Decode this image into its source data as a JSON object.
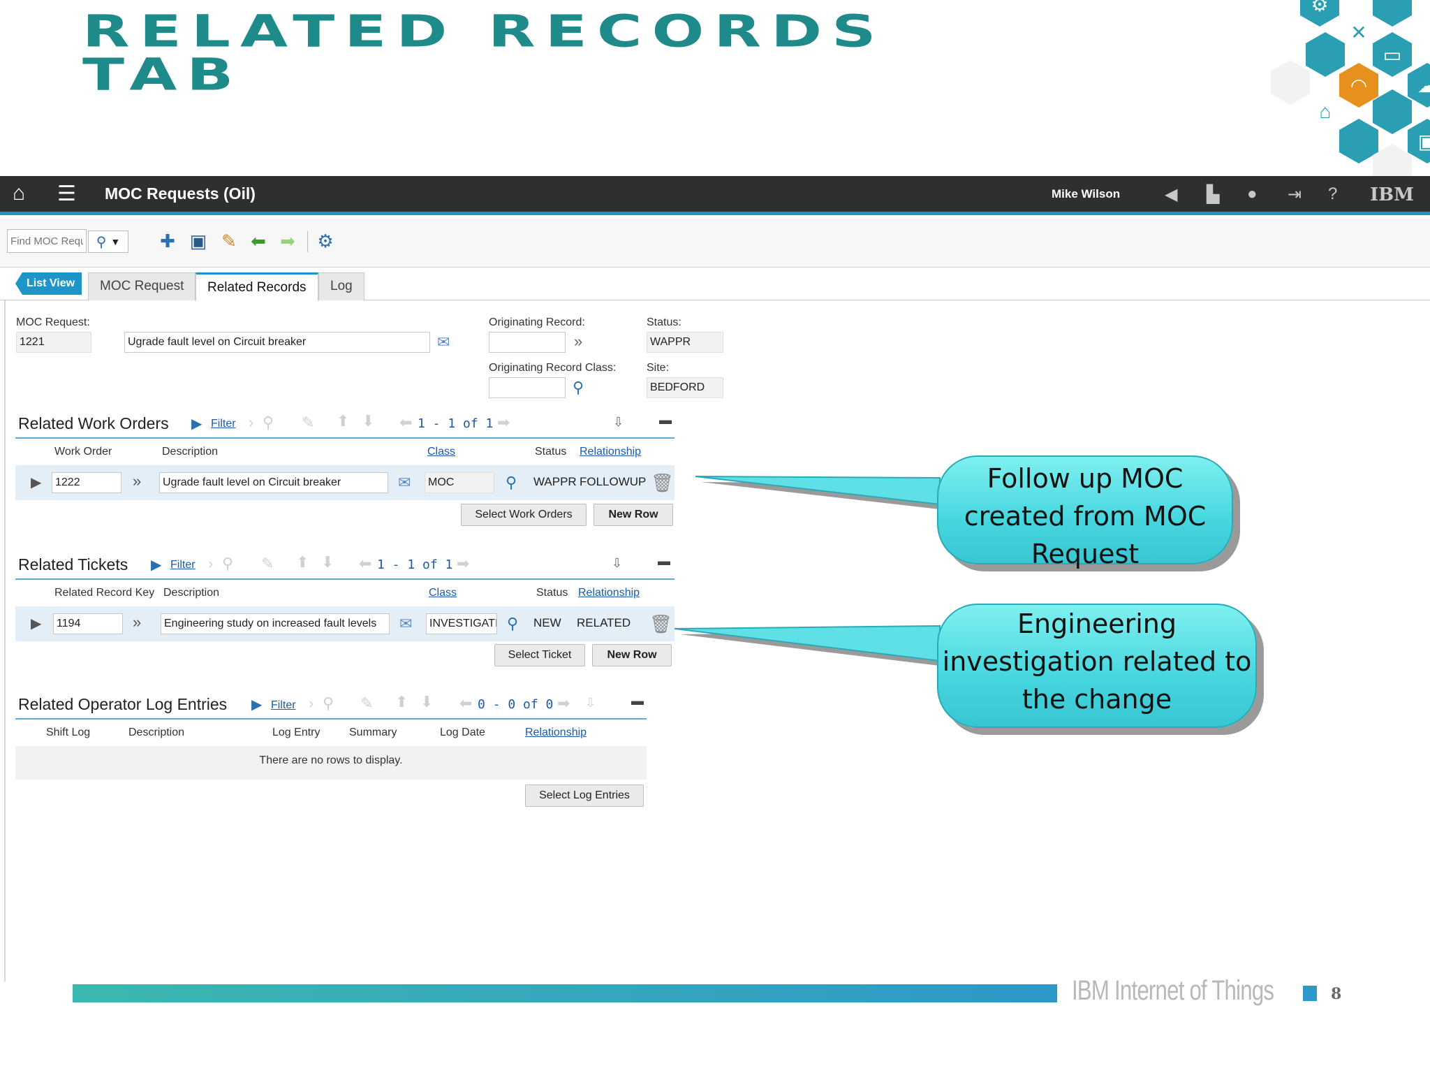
{
  "slide": {
    "title_line1": "RELATED RECORDS",
    "title_line2": "TAB"
  },
  "app": {
    "title": "MOC Requests (Oil)",
    "user": "Mike Wilson",
    "brand": "IBM",
    "accent_color": "#1d95c8"
  },
  "toolbar": {
    "find_placeholder": "Find MOC Request"
  },
  "tabs": {
    "list_view": "List View",
    "items": [
      "MOC Request",
      "Related Records",
      "Log"
    ],
    "active": "Related Records"
  },
  "header_fields": {
    "moc_request_label": "MOC Request:",
    "moc_request_value": "1221",
    "moc_description": "Ugrade fault level on Circuit breaker",
    "originating_record_label": "Originating Record:",
    "originating_record_value": "",
    "originating_class_label": "Originating Record Class:",
    "originating_class_value": "",
    "status_label": "Status:",
    "status_value": "WAPPR",
    "site_label": "Site:",
    "site_value": "BEDFORD"
  },
  "work_orders": {
    "title": "Related Work Orders",
    "filter": "Filter",
    "pager": "1 - 1 of 1",
    "columns": [
      "Work Order",
      "Description",
      "Class",
      "Status",
      "Relationship"
    ],
    "row": {
      "work_order": "1222",
      "description": "Ugrade fault level on Circuit breaker",
      "class": "MOC",
      "status": "WAPPR",
      "relationship": "FOLLOWUP"
    },
    "select_button": "Select Work Orders",
    "new_row_button": "New Row"
  },
  "tickets": {
    "title": "Related Tickets",
    "filter": "Filter",
    "pager": "1 - 1 of 1",
    "columns": [
      "Related Record Key",
      "Description",
      "Class",
      "Status",
      "Relationship"
    ],
    "row": {
      "key": "1194",
      "description": "Engineering study on increased fault levels",
      "class": "INVESTIGATIO",
      "status": "NEW",
      "relationship": "RELATED"
    },
    "select_button": "Select Ticket",
    "new_row_button": "New Row"
  },
  "log_entries": {
    "title": "Related Operator Log Entries",
    "filter": "Filter",
    "pager": "0 - 0 of 0",
    "columns": [
      "Shift Log",
      "Description",
      "Log Entry",
      "Summary",
      "Log Date",
      "Relationship"
    ],
    "empty_message": "There are no rows to display.",
    "select_button": "Select Log Entries"
  },
  "callouts": {
    "followup": "Follow up MOC created from MOC Request",
    "engineering": "Engineering investigation related to the change"
  },
  "footer": {
    "brand_text": "IBM Internet of Things",
    "page_number": "8"
  }
}
